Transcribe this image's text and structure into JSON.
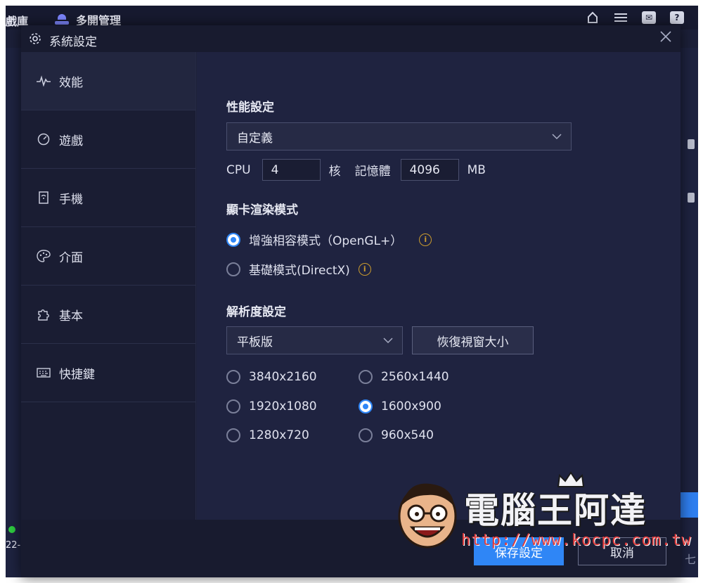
{
  "background_app": {
    "library_label": "戲庫",
    "multi_instance_label": "多開管理",
    "left_strip_text": "22-",
    "right_strip_text": "七"
  },
  "dialog": {
    "title": "系統設定",
    "close_icon": "close-icon",
    "sidebar": {
      "items": [
        {
          "label": "效能",
          "icon": "pulse-icon",
          "active": true
        },
        {
          "label": "遊戲",
          "icon": "game-icon",
          "active": false
        },
        {
          "label": "手機",
          "icon": "phone-icon",
          "active": false
        },
        {
          "label": "介面",
          "icon": "palette-icon",
          "active": false
        },
        {
          "label": "基本",
          "icon": "puzzle-icon",
          "active": false
        },
        {
          "label": "快捷鍵",
          "icon": "keyboard-icon",
          "active": false
        }
      ]
    },
    "performance": {
      "section_title": "性能設定",
      "preset_value": "自定義",
      "cpu_label": "CPU",
      "cpu_value": "4",
      "cpu_unit": "核",
      "memory_label": "記憶體",
      "memory_value": "4096",
      "memory_unit": "MB"
    },
    "graphics": {
      "section_title": "顯卡渲染模式",
      "options": [
        {
          "label": "增強相容模式（OpenGL+）",
          "selected": true
        },
        {
          "label": "基礎模式(DirectX)",
          "selected": false
        }
      ]
    },
    "resolution": {
      "section_title": "解析度設定",
      "preset_value": "平板版",
      "restore_button": "恢復視窗大小",
      "options": [
        {
          "label": "3840x2160",
          "selected": false
        },
        {
          "label": "2560x1440",
          "selected": false
        },
        {
          "label": "1920x1080",
          "selected": false
        },
        {
          "label": "1600x900",
          "selected": true
        },
        {
          "label": "1280x720",
          "selected": false
        },
        {
          "label": "960x540",
          "selected": false
        }
      ]
    },
    "footer": {
      "save_button": "保存設定",
      "cancel_button": "取消"
    }
  },
  "watermark": {
    "title": "電腦王阿達",
    "url": "http://www.kocpc.com.tw"
  },
  "colors": {
    "accent": "#2f86f6",
    "dialog_bg": "#1d2139",
    "info": "#c99a2e"
  }
}
